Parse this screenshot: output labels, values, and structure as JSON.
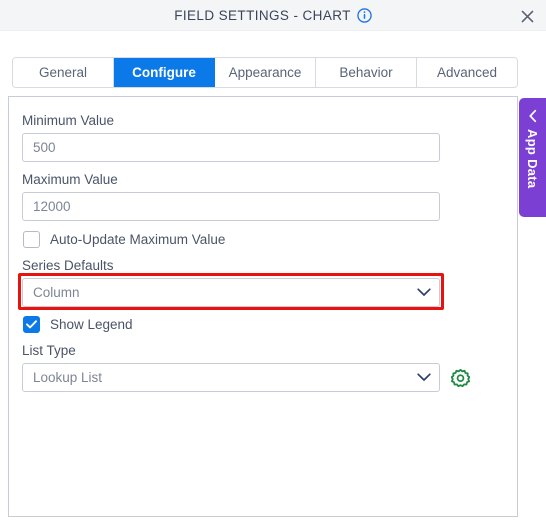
{
  "header": {
    "title": "FIELD SETTINGS - CHART",
    "info_icon": "info-circle-icon",
    "close_icon": "close-icon"
  },
  "tabs": [
    {
      "label": "General",
      "active": false
    },
    {
      "label": "Configure",
      "active": true
    },
    {
      "label": "Appearance",
      "active": false
    },
    {
      "label": "Behavior",
      "active": false
    },
    {
      "label": "Advanced",
      "active": false
    }
  ],
  "form": {
    "minimum_value": {
      "label": "Minimum Value",
      "value": "500",
      "placeholder": "500"
    },
    "maximum_value": {
      "label": "Maximum Value",
      "value": "12000",
      "placeholder": "12000"
    },
    "auto_update_maximum": {
      "label": "Auto-Update Maximum Value",
      "checked": false
    },
    "series_defaults": {
      "label": "Series Defaults",
      "value": "Column",
      "highlighted": true,
      "highlight_color": "#e8120f"
    },
    "show_legend": {
      "label": "Show Legend",
      "checked": true
    },
    "list_type": {
      "label": "List Type",
      "value": "Lookup List",
      "settings_icon": "gear-icon",
      "settings_icon_color": "#1f8a45"
    }
  },
  "side_panel": {
    "label": "App Data",
    "collapse_icon": "chevron-left-icon",
    "color": "#7c3fd4"
  },
  "theme": {
    "accent": "#0b79e8",
    "header_bg": "#f4f5f7",
    "border": "#c8ccd6",
    "text": "#4a5467"
  }
}
